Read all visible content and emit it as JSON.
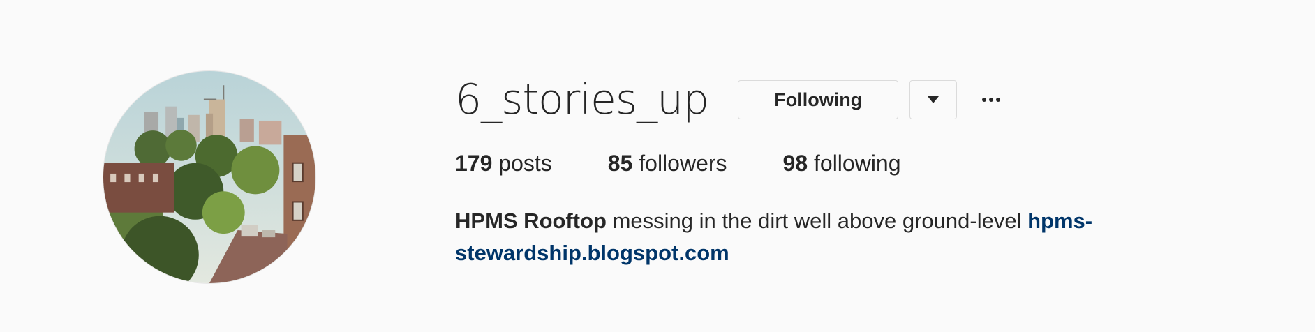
{
  "profile": {
    "username": "6_stories_up",
    "follow_button": "Following",
    "stats": {
      "posts_count": "179",
      "posts_label": "posts",
      "followers_count": "85",
      "followers_label": "followers",
      "following_count": "98",
      "following_label": "following"
    },
    "bio": {
      "name": "HPMS Rooftop",
      "text": "messing in the dirt well above ground-level",
      "link_line1": "hpms-",
      "link_line2": "stewardship.blogspot.com"
    }
  },
  "icons": {
    "dropdown": "chevron-down-icon",
    "more": "more-options-icon"
  },
  "colors": {
    "background": "#fafafa",
    "text": "#262626",
    "link": "#003569",
    "border": "#dbdbdb"
  }
}
